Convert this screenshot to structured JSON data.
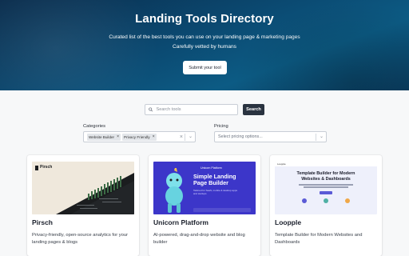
{
  "hero": {
    "title": "Landing Tools Directory",
    "subtitle_line1": "Curated list of the best tools you can use on your landing page & marketing pages",
    "subtitle_line2": "Carefully vetted by humans",
    "submit_label": "Submit your tool"
  },
  "search": {
    "placeholder": "Search tools",
    "button_label": "Search"
  },
  "filters": {
    "categories_label": "Categories",
    "selected_categories": [
      "Website Builder",
      "Privacy Friendly"
    ],
    "pricing_label": "Pricing",
    "pricing_placeholder": "Select pricing options..."
  },
  "cards": [
    {
      "title": "Pirsch",
      "description": "Privacy-friendly, open-source analytics for your landing pages & blogs",
      "thumb_logo": "Pirsch"
    },
    {
      "title": "Unicorn Platform",
      "description": "AI-powered, drag-and-drop website and blog builder",
      "thumb_brand": "Unicorn Platform",
      "thumb_heading": "Simple Landing Page Builder",
      "thumb_sub": "Tailored for SaaS, mobile & desktop apps and startups"
    },
    {
      "title": "Loopple",
      "description": "Template Builder for Modern Websites and Dashboards",
      "thumb_brand": "Loopple",
      "thumb_heading": "Template Builder for Modern Websites & Dashboards"
    }
  ],
  "colors": {
    "hero_gradient": [
      "#0a2d4d",
      "#0c5b84"
    ],
    "search_button": "#2a3340",
    "unicorn_bg": "#3c36c9",
    "pirsch_bg": "#efe8dc"
  },
  "icons": {
    "search": "search-icon",
    "remove_chip": "close-icon",
    "clear": "close-icon",
    "caret": "chevron-down-icon"
  }
}
